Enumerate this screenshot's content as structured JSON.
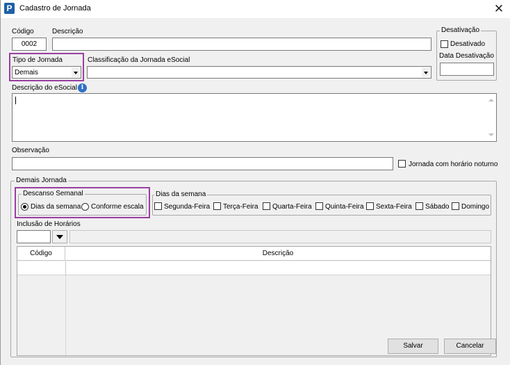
{
  "window": {
    "title": "Cadastro de Jornada",
    "icon": "app-p-icon",
    "close_icon": "close-icon"
  },
  "codigo": {
    "label": "Código",
    "value": "0002"
  },
  "descricao": {
    "label": "Descrição",
    "value": ""
  },
  "desativacao": {
    "group_title": "Desativação",
    "checkbox_label": "Desativado",
    "checked": false,
    "date_label": "Data Desativação",
    "date_value": ""
  },
  "tipo_jornada": {
    "label": "Tipo de Jornada",
    "value": "Demais"
  },
  "classificacao": {
    "label": "Classificação da Jornada eSocial",
    "value": ""
  },
  "descricao_esocial": {
    "label": "Descrição do eSocial",
    "value": "",
    "info_icon": "info-icon"
  },
  "observacao": {
    "label": "Observação",
    "value": ""
  },
  "noturno": {
    "label": "Jornada com horário noturno",
    "checked": false
  },
  "demais_jornada": {
    "group_title": "Demais Jornada",
    "descanso": {
      "group_title": "Descanso Semanal",
      "options": [
        {
          "label": "Dias da semana",
          "selected": true
        },
        {
          "label": "Conforme escala",
          "selected": false
        }
      ]
    },
    "dias": {
      "group_title": "Dias da semana",
      "days": [
        {
          "label": "Segunda-Feira",
          "checked": false
        },
        {
          "label": "Terça-Feira",
          "checked": false
        },
        {
          "label": "Quarta-Feira",
          "checked": false
        },
        {
          "label": "Quinta-Feira",
          "checked": false
        },
        {
          "label": "Sexta-Feira",
          "checked": false
        },
        {
          "label": "Sábado",
          "checked": false
        },
        {
          "label": "Domingo",
          "checked": false
        }
      ]
    },
    "inclusao": {
      "label": "Inclusão de Horários",
      "grid_columns": [
        "Código",
        "Descrição"
      ]
    }
  },
  "buttons": {
    "save": "Salvar",
    "cancel": "Cancelar"
  },
  "colors": {
    "highlight": "#9a3fa3",
    "info_icon": "#2f6fc8",
    "app_icon": "#1f5fa8"
  }
}
